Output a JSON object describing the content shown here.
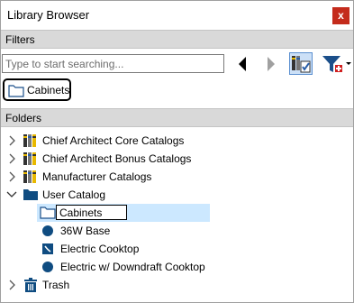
{
  "window": {
    "title": "Library Browser",
    "close_glyph": "x"
  },
  "filters": {
    "header": "Filters",
    "search_placeholder": "Type to start searching...",
    "search_value": "",
    "active_filter_chip": "Cabinets"
  },
  "folders": {
    "header": "Folders",
    "items": [
      {
        "label": "Chief Architect Core Catalogs",
        "icon": "catalog-books-icon",
        "expanded": false,
        "level": 0
      },
      {
        "label": "Chief Architect Bonus Catalogs",
        "icon": "catalog-books-icon",
        "expanded": false,
        "level": 0
      },
      {
        "label": "Manufacturer Catalogs",
        "icon": "catalog-books-icon",
        "expanded": false,
        "level": 0
      },
      {
        "label": "User Catalog",
        "icon": "folder-filled-icon",
        "expanded": true,
        "level": 0
      },
      {
        "label": "Cabinets",
        "icon": "folder-outline-icon",
        "level": 1,
        "selected": true,
        "renaming": true
      },
      {
        "label": "36W Base",
        "icon": "object-dot-icon",
        "level": 1
      },
      {
        "label": "Electric Cooktop",
        "icon": "cooktop-icon",
        "level": 1
      },
      {
        "label": "Electric w/ Downdraft Cooktop",
        "icon": "object-dot-icon",
        "level": 1
      },
      {
        "label": "Trash",
        "icon": "trash-icon",
        "expanded": false,
        "level": 0
      }
    ]
  },
  "colors": {
    "accent": "#0f4c81",
    "selection": "#cce8ff",
    "close": "#c42b1c",
    "header_bg": "#d9d9d9"
  }
}
